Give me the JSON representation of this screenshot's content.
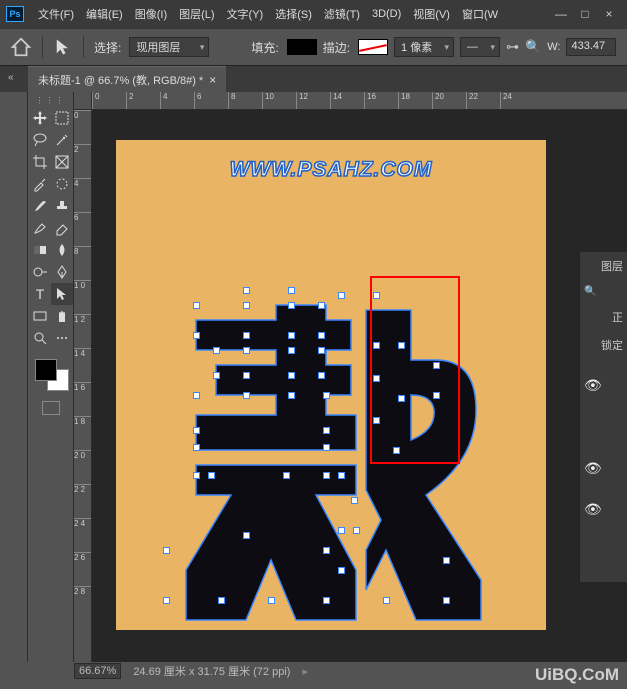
{
  "app": {
    "logo_text": "Ps",
    "menu": {
      "file": "文件(F)",
      "edit": "编辑(E)",
      "image": "图像(I)",
      "layer": "图层(L)",
      "type": "文字(Y)",
      "select": "选择(S)",
      "filter": "滤镜(T)",
      "3d": "3D(D)",
      "view": "视图(V)",
      "window": "窗口(W"
    },
    "win": {
      "min": "—",
      "max": "□",
      "close": "×"
    }
  },
  "options": {
    "select_label": "选择:",
    "select_value": "现用图层",
    "fill_label": "填充:",
    "stroke_label": "描边:",
    "stroke_weight": "1 像素",
    "align_icon": "—",
    "w_label": "W:",
    "w_value": "433.47"
  },
  "tab": {
    "title": "未标题-1 @ 66.7% (教, RGB/8#) *",
    "close": "×"
  },
  "ruler_h": [
    "0",
    "2",
    "4",
    "6",
    "8",
    "10",
    "12",
    "14",
    "16",
    "18",
    "20",
    "22",
    "24"
  ],
  "ruler_v": [
    "0",
    "2",
    "4",
    "6",
    "8",
    "1\n0",
    "1\n2",
    "1\n4",
    "1\n6",
    "1\n8",
    "2\n0",
    "2\n2",
    "2\n4",
    "2\n6",
    "2\n8"
  ],
  "canvas": {
    "watermark": "WWW.PSAHZ.COM"
  },
  "right_panel": {
    "label1": "图层",
    "search": "🔍",
    "label2": "正",
    "lock": "锁定"
  },
  "status": {
    "zoom": "66.67%",
    "dims": "24.69 厘米 x 31.75 厘米 (72 ppi)"
  },
  "brand": "UiBQ.CoM"
}
